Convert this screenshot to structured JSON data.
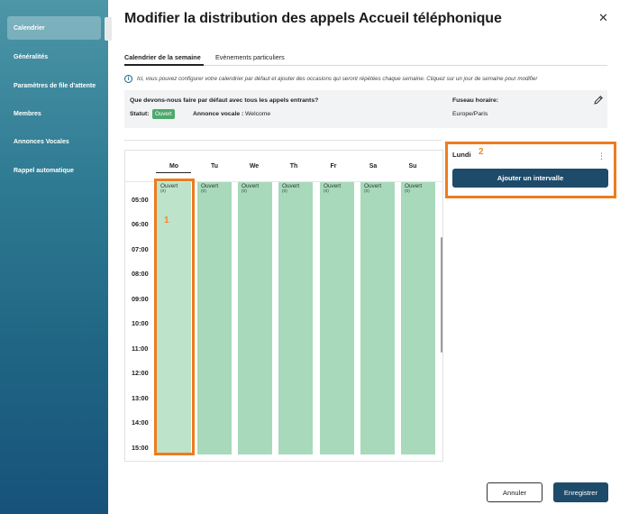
{
  "sidebar": {
    "items": [
      {
        "label": "Calendrier",
        "active": true
      },
      {
        "label": "Généralités",
        "active": false
      },
      {
        "label": "Paramètres de file d'attente",
        "active": false
      },
      {
        "label": "Membres",
        "active": false
      },
      {
        "label": "Annonces Vocales",
        "active": false
      },
      {
        "label": "Rappel automatique",
        "active": false
      }
    ]
  },
  "header": {
    "title": "Modifier la distribution des appels Accueil téléphonique",
    "close_icon": "close-icon"
  },
  "tabs": [
    {
      "label": "Calendrier de la semaine",
      "active": true
    },
    {
      "label": "Evènements particuliers",
      "active": false
    }
  ],
  "info": {
    "text": "Ici, vous pouvez configurer votre calendrier par défaut et ajouter des occasions qui seront répétées chaque semaine. Cliquez sur un jour de semaine pour modifier"
  },
  "defaults": {
    "question": "Que devons-nous faire par défaut avec tous les appels entrants?",
    "statut_label": "Statut:",
    "statut_value": "Ouvert",
    "annonce_label": "Annonce vocale :",
    "annonce_value": "Welcome",
    "timezone_label": "Fuseau horaire:",
    "timezone_value": "Europe/Paris"
  },
  "calendar": {
    "days": [
      "Mo",
      "Tu",
      "We",
      "Th",
      "Fr",
      "Sa",
      "Su"
    ],
    "selected_day": "Mo",
    "times": [
      "05:00",
      "06:00",
      "07:00",
      "08:00",
      "09:00",
      "10:00",
      "11:00",
      "12:00",
      "13:00",
      "14:00",
      "15:00"
    ],
    "block_label": "Ouvert",
    "block_sub": "(0)"
  },
  "annotations": {
    "marker_1": "1",
    "marker_2": "2"
  },
  "detail": {
    "day_title": "Lundi",
    "add_button": "Ajouter un intervalle"
  },
  "footer": {
    "cancel": "Annuler",
    "save": "Enregistrer"
  },
  "colors": {
    "accent": "#1e4b69",
    "open_green": "#a8d9bb",
    "badge_green": "#4caa6c",
    "highlight_orange": "#ed7c1f"
  }
}
